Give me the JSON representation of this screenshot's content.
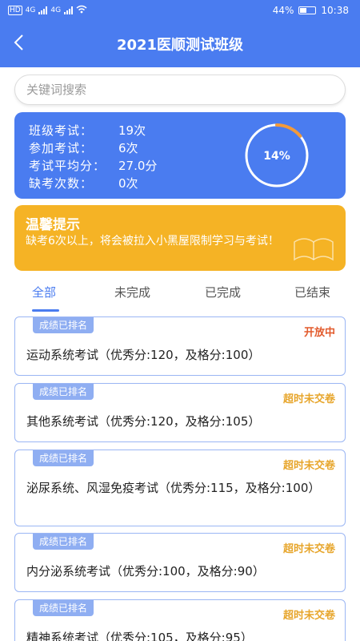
{
  "status_bar": {
    "network_1": "4G",
    "network_2": "4G",
    "battery": "44%",
    "time": "10:38"
  },
  "header": {
    "title": "2021医顺测试班级"
  },
  "search": {
    "placeholder": "关键词搜索"
  },
  "summary": {
    "class_exams_label": "班级考试：",
    "class_exams_value": "19次",
    "attended_label": "参加考试：",
    "attended_value": "6次",
    "avg_score_label": "考试平均分：",
    "avg_score_value": "27.0分",
    "absent_label": "缺考次数：",
    "absent_value": "0次",
    "progress_text": "14%",
    "progress_fraction": 0.14
  },
  "tips": {
    "title": "温馨提示",
    "text": "缺考6次以上，将会被拉入小黑屋限制学习与考试！"
  },
  "tabs": [
    "全部",
    "未完成",
    "已完成",
    "已结束"
  ],
  "exams": [
    {
      "badge": "成绩已排名",
      "status": "开放中",
      "status_type": "open",
      "title": "运动系统考试（优秀分:120，及格分:100）"
    },
    {
      "badge": "成绩已排名",
      "status": "超时未交卷",
      "status_type": "late",
      "title": "其他系统考试（优秀分:120，及格分:105）"
    },
    {
      "badge": "成绩已排名",
      "status": "超时未交卷",
      "status_type": "late",
      "title": "泌尿系统、风湿免疫考试（优秀分:115，及格分:100）"
    },
    {
      "badge": "成绩已排名",
      "status": "超时未交卷",
      "status_type": "late",
      "title": "内分泌系统考试（优秀分:100，及格分:90）"
    },
    {
      "badge": "成绩已排名",
      "status": "超时未交卷",
      "status_type": "late",
      "title": "精神系统考试（优秀分:105，及格分:95）"
    }
  ],
  "colors": {
    "primary": "#4a7cf0",
    "warning": "#f5b325",
    "open": "#e25a2c",
    "late": "#e7a52a"
  }
}
